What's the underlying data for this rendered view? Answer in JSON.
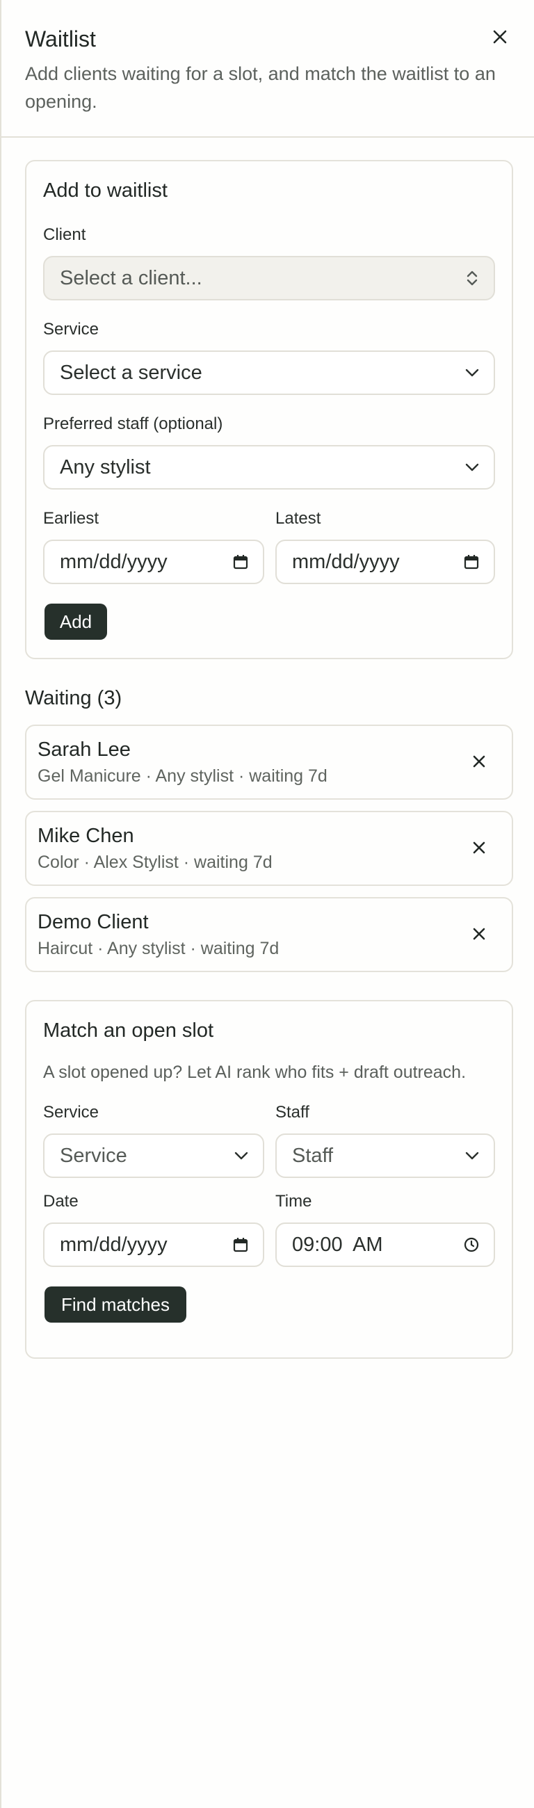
{
  "header": {
    "title": "Waitlist",
    "subtitle": "Add clients waiting for a slot, and match the waitlist to an opening.",
    "close_icon": "close-icon"
  },
  "add_form": {
    "title": "Add to waitlist",
    "client_label": "Client",
    "client_placeholder": "Select a client...",
    "service_label": "Service",
    "service_placeholder": "Select a service",
    "staff_label": "Preferred staff (optional)",
    "staff_value": "Any stylist",
    "earliest_label": "Earliest",
    "earliest_value": "mm/dd/yyyy",
    "latest_label": "Latest",
    "latest_value": "mm/dd/yyyy",
    "add_button": "Add"
  },
  "waiting": {
    "title": "Waiting (3)",
    "items": [
      {
        "name": "Sarah Lee",
        "meta": "Gel Manicure · Any stylist · waiting 7d"
      },
      {
        "name": "Mike Chen",
        "meta": "Color · Alex Stylist · waiting 7d"
      },
      {
        "name": "Demo Client",
        "meta": "Haircut · Any stylist · waiting 7d"
      }
    ]
  },
  "match_form": {
    "title": "Match an open slot",
    "hint": "A slot opened up? Let AI rank who fits + draft outreach.",
    "service_label": "Service",
    "service_placeholder": "Service",
    "staff_label": "Staff",
    "staff_placeholder": "Staff",
    "date_label": "Date",
    "date_value": "mm/dd/yyyy",
    "time_label": "Time",
    "time_value": "09:00  AM",
    "find_button": "Find matches"
  },
  "colors": {
    "accent_button": "#26302b",
    "border": "#e4e2da",
    "muted_text": "#5f645f"
  }
}
